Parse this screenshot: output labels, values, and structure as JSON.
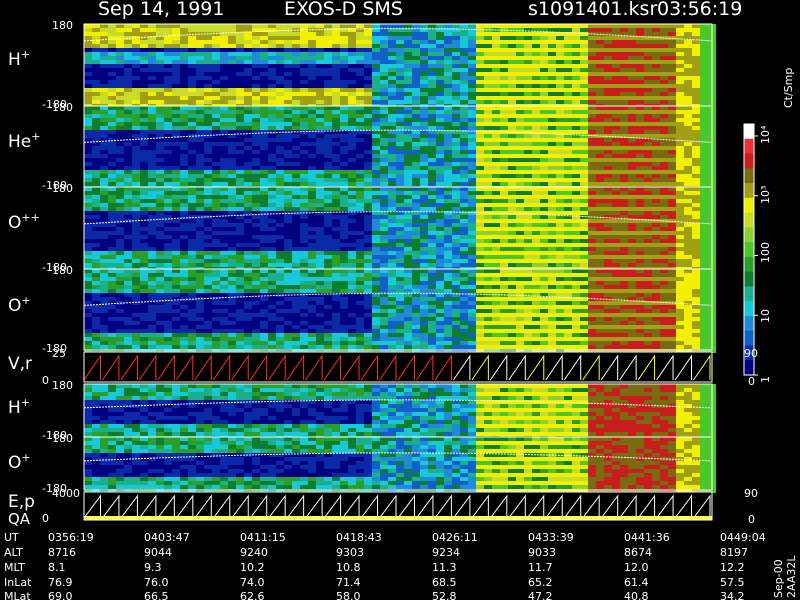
{
  "header": {
    "date": "Sep 14, 1991",
    "instrument": "EXOS-D SMS",
    "file": "s1091401.ksr",
    "time": "03:56:19"
  },
  "chart_data": {
    "type": "heatmap",
    "title": "Sep 14, 1991   EXOS-D SMS",
    "panels": [
      {
        "name": "H+",
        "ion": "H",
        "charge": "+",
        "ytop": "180",
        "ybot": "-180",
        "ylim": [
          -180,
          180
        ]
      },
      {
        "name": "He+",
        "ion": "He",
        "charge": "+",
        "ytop": "180",
        "ybot": "-180",
        "ylim": [
          -180,
          180
        ]
      },
      {
        "name": "O++",
        "ion": "O",
        "charge": "++",
        "ytop": "180",
        "ybot": "-180",
        "ylim": [
          -180,
          180
        ]
      },
      {
        "name": "O+",
        "ion": "O",
        "charge": "+",
        "ytop": "180",
        "ybot": "-180",
        "ylim": [
          -180,
          180
        ]
      },
      {
        "name": "V,r",
        "ion": "V,r",
        "charge": "",
        "ytop": "25",
        "ybot": "0",
        "ylim": [
          0,
          25
        ],
        "right_top": "90",
        "right_bot": "0"
      },
      {
        "name": "H+",
        "ion": "H",
        "charge": "+",
        "ytop": "180",
        "ybot": "-180",
        "ylim": [
          -180,
          180
        ]
      },
      {
        "name": "O+",
        "ion": "O",
        "charge": "+",
        "ytop": "180",
        "ybot": "-180",
        "ylim": [
          -180,
          180
        ]
      },
      {
        "name": "E,p",
        "ion": "E,p",
        "charge": "",
        "ytop": "4000",
        "ybot": "0",
        "ylim": [
          0,
          4000
        ],
        "right_top": "90",
        "right_bot": "0"
      }
    ],
    "qa_label": "QA",
    "colorbar": {
      "unit": "Ct/Smp",
      "ticks": [
        {
          "label": "1",
          "value": 1
        },
        {
          "label": "10",
          "value": 10
        },
        {
          "label": "100",
          "value": 100
        },
        {
          "label": "10³",
          "value": 1000
        },
        {
          "label": "10⁴",
          "value": 10000
        }
      ]
    },
    "x_axis": {
      "rows": [
        {
          "label": "UT",
          "values": [
            "0356:19",
            "0403:47",
            "0411:15",
            "0418:43",
            "0426:11",
            "0433:39",
            "0441:36",
            "0449:04"
          ]
        },
        {
          "label": "ALT",
          "values": [
            "8716",
            "9044",
            "9240",
            "9303",
            "9234",
            "9033",
            "8674",
            "8197"
          ]
        },
        {
          "label": "MLT",
          "values": [
            "8.1",
            "9.3",
            "10.2",
            "10.8",
            "11.3",
            "11.7",
            "12.0",
            "12.2"
          ]
        },
        {
          "label": "InLat",
          "values": [
            "76.9",
            "76.0",
            "74.0",
            "71.4",
            "68.5",
            "65.2",
            "61.4",
            "57.5"
          ]
        },
        {
          "label": "MLat",
          "values": [
            "69.0",
            "66.5",
            "62.6",
            "58.0",
            "52.8",
            "47.2",
            "40.8",
            "34.2"
          ]
        }
      ]
    },
    "footer_code": "Sep-00  2AA32L"
  }
}
